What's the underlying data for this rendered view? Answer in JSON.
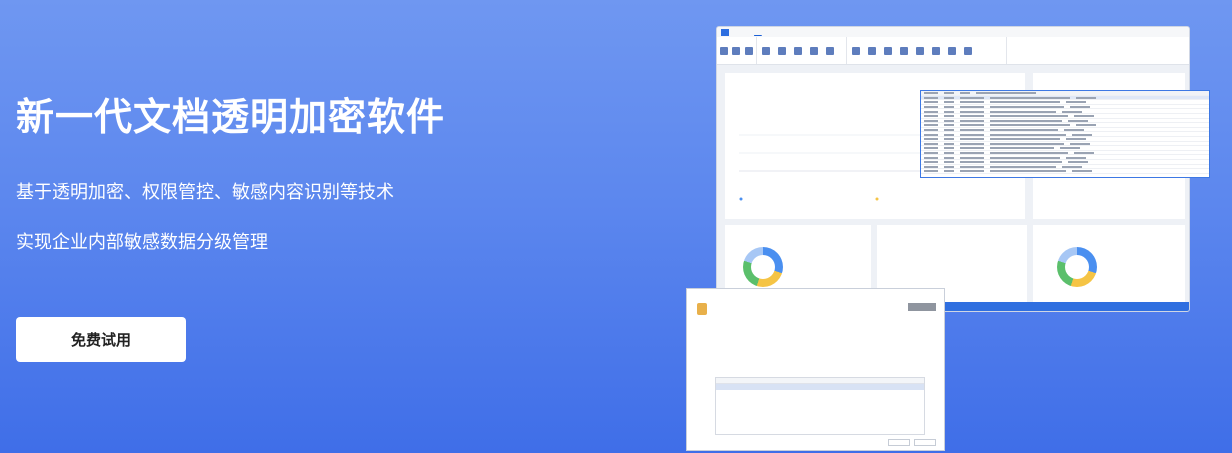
{
  "hero": {
    "title": "新一代文档透明加密软件",
    "line1": "基于透明加密、权限管控、敏感内容识别等技术",
    "line2": "实现企业内部敏感数据分级管理",
    "cta_label": "免费试用"
  },
  "colors": {
    "accent": "#2f6fe0",
    "background_top": "#6f97f1",
    "background_bottom": "#3f6ee8"
  }
}
